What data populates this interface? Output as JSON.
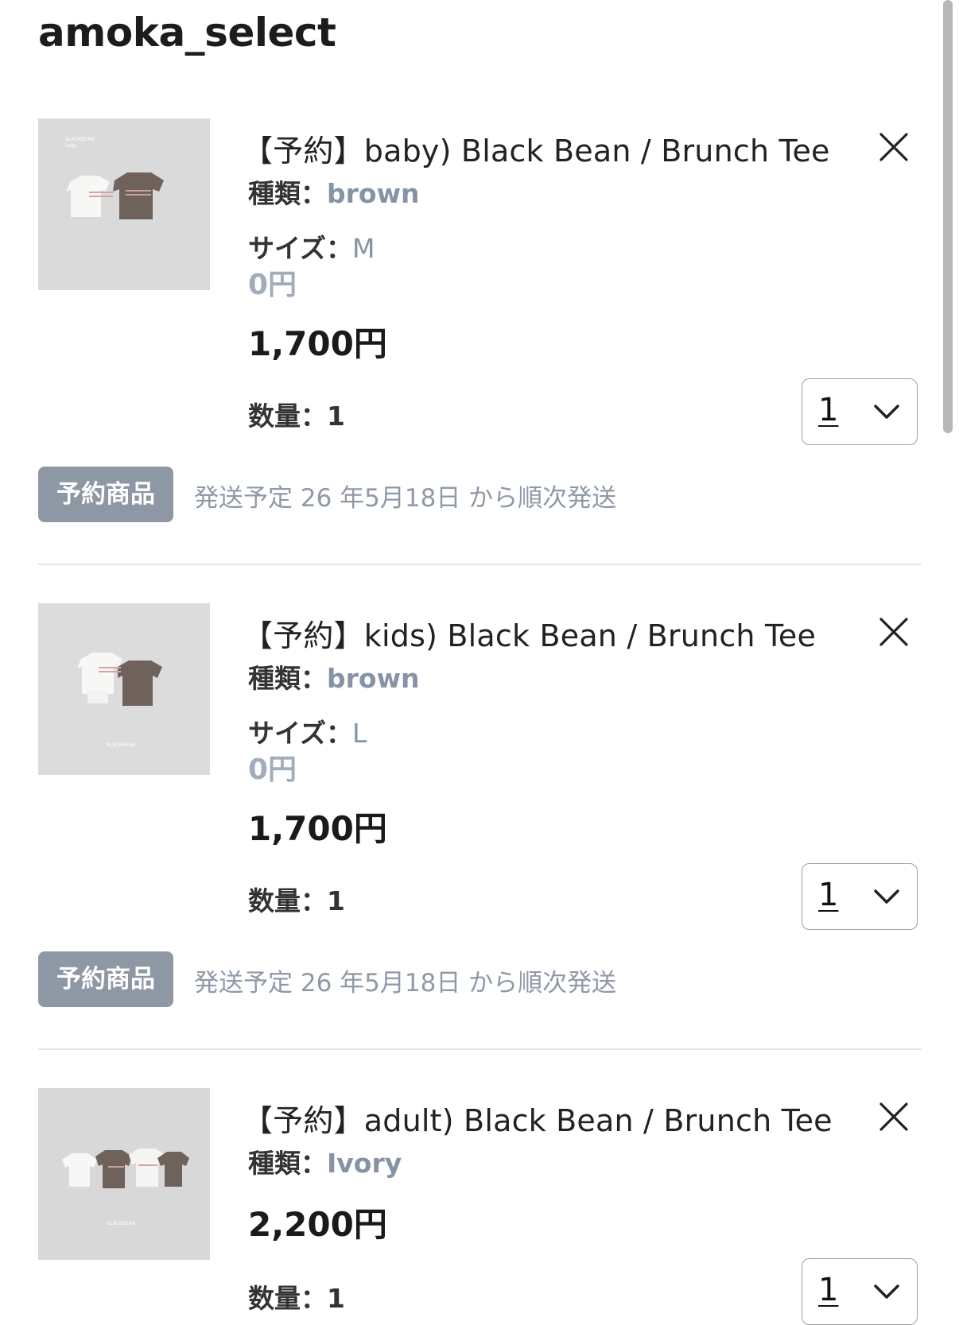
{
  "shop": {
    "name": "amoka_select"
  },
  "items": [
    {
      "title": "【予約】baby) Black Bean  / Brunch  Tee",
      "type_label": "種類：",
      "type_value": "brown",
      "size_label": "サイズ：",
      "size_value": "M",
      "zero_price": "0円",
      "price": "1,700円",
      "qty_label": "数量：1",
      "qty_selected": "1",
      "badge": "予約商品",
      "ship_note": "発送予定 26 年5月18日 から順次発送"
    },
    {
      "title": "【予約】kids) Black Bean  / Brunch  Tee",
      "type_label": "種類：",
      "type_value": "brown",
      "size_label": "サイズ：",
      "size_value": "L",
      "zero_price": "0円",
      "price": "1,700円",
      "qty_label": "数量：1",
      "qty_selected": "1",
      "badge": "予約商品",
      "ship_note": "発送予定 26 年5月18日 から順次発送"
    },
    {
      "title": "【予約】adult) Black Bean  / Brunch  Tee",
      "type_label": "種類：",
      "type_value": "Ivory",
      "price": "2,200円",
      "qty_label": "数量：1",
      "qty_selected": "1"
    }
  ],
  "icons": {
    "remove": "close-icon",
    "dropdown": "chevron-down-icon"
  },
  "colors": {
    "accent_value": "#8593a7",
    "badge_bg": "#8e97a4",
    "ship_note": "#8f99a7"
  }
}
